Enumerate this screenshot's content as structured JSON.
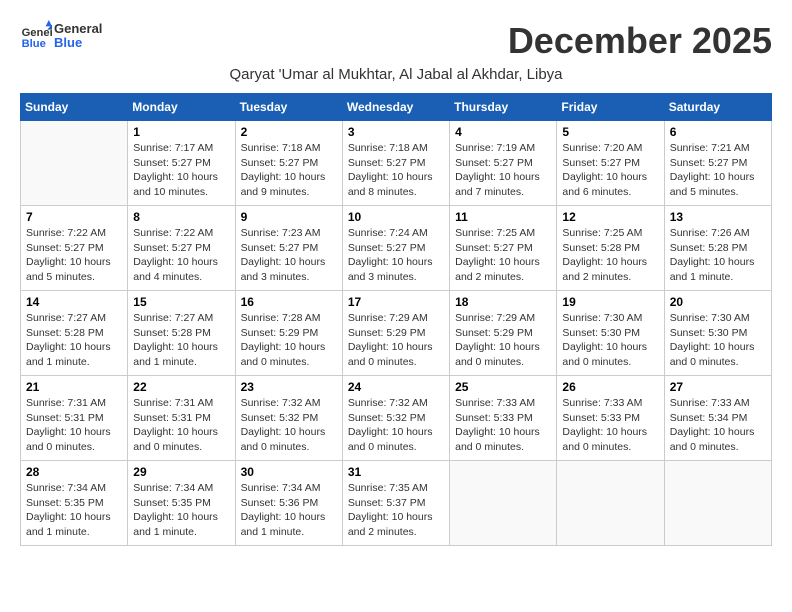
{
  "logo": {
    "general": "General",
    "blue": "Blue"
  },
  "title": "December 2025",
  "location": "Qaryat 'Umar al Mukhtar, Al Jabal al Akhdar, Libya",
  "weekdays": [
    "Sunday",
    "Monday",
    "Tuesday",
    "Wednesday",
    "Thursday",
    "Friday",
    "Saturday"
  ],
  "weeks": [
    [
      {
        "day": "",
        "info": ""
      },
      {
        "day": "1",
        "info": "Sunrise: 7:17 AM\nSunset: 5:27 PM\nDaylight: 10 hours\nand 10 minutes."
      },
      {
        "day": "2",
        "info": "Sunrise: 7:18 AM\nSunset: 5:27 PM\nDaylight: 10 hours\nand 9 minutes."
      },
      {
        "day": "3",
        "info": "Sunrise: 7:18 AM\nSunset: 5:27 PM\nDaylight: 10 hours\nand 8 minutes."
      },
      {
        "day": "4",
        "info": "Sunrise: 7:19 AM\nSunset: 5:27 PM\nDaylight: 10 hours\nand 7 minutes."
      },
      {
        "day": "5",
        "info": "Sunrise: 7:20 AM\nSunset: 5:27 PM\nDaylight: 10 hours\nand 6 minutes."
      },
      {
        "day": "6",
        "info": "Sunrise: 7:21 AM\nSunset: 5:27 PM\nDaylight: 10 hours\nand 5 minutes."
      }
    ],
    [
      {
        "day": "7",
        "info": "Sunrise: 7:22 AM\nSunset: 5:27 PM\nDaylight: 10 hours\nand 5 minutes."
      },
      {
        "day": "8",
        "info": "Sunrise: 7:22 AM\nSunset: 5:27 PM\nDaylight: 10 hours\nand 4 minutes."
      },
      {
        "day": "9",
        "info": "Sunrise: 7:23 AM\nSunset: 5:27 PM\nDaylight: 10 hours\nand 3 minutes."
      },
      {
        "day": "10",
        "info": "Sunrise: 7:24 AM\nSunset: 5:27 PM\nDaylight: 10 hours\nand 3 minutes."
      },
      {
        "day": "11",
        "info": "Sunrise: 7:25 AM\nSunset: 5:27 PM\nDaylight: 10 hours\nand 2 minutes."
      },
      {
        "day": "12",
        "info": "Sunrise: 7:25 AM\nSunset: 5:28 PM\nDaylight: 10 hours\nand 2 minutes."
      },
      {
        "day": "13",
        "info": "Sunrise: 7:26 AM\nSunset: 5:28 PM\nDaylight: 10 hours\nand 1 minute."
      }
    ],
    [
      {
        "day": "14",
        "info": "Sunrise: 7:27 AM\nSunset: 5:28 PM\nDaylight: 10 hours\nand 1 minute."
      },
      {
        "day": "15",
        "info": "Sunrise: 7:27 AM\nSunset: 5:28 PM\nDaylight: 10 hours\nand 1 minute."
      },
      {
        "day": "16",
        "info": "Sunrise: 7:28 AM\nSunset: 5:29 PM\nDaylight: 10 hours\nand 0 minutes."
      },
      {
        "day": "17",
        "info": "Sunrise: 7:29 AM\nSunset: 5:29 PM\nDaylight: 10 hours\nand 0 minutes."
      },
      {
        "day": "18",
        "info": "Sunrise: 7:29 AM\nSunset: 5:29 PM\nDaylight: 10 hours\nand 0 minutes."
      },
      {
        "day": "19",
        "info": "Sunrise: 7:30 AM\nSunset: 5:30 PM\nDaylight: 10 hours\nand 0 minutes."
      },
      {
        "day": "20",
        "info": "Sunrise: 7:30 AM\nSunset: 5:30 PM\nDaylight: 10 hours\nand 0 minutes."
      }
    ],
    [
      {
        "day": "21",
        "info": "Sunrise: 7:31 AM\nSunset: 5:31 PM\nDaylight: 10 hours\nand 0 minutes."
      },
      {
        "day": "22",
        "info": "Sunrise: 7:31 AM\nSunset: 5:31 PM\nDaylight: 10 hours\nand 0 minutes."
      },
      {
        "day": "23",
        "info": "Sunrise: 7:32 AM\nSunset: 5:32 PM\nDaylight: 10 hours\nand 0 minutes."
      },
      {
        "day": "24",
        "info": "Sunrise: 7:32 AM\nSunset: 5:32 PM\nDaylight: 10 hours\nand 0 minutes."
      },
      {
        "day": "25",
        "info": "Sunrise: 7:33 AM\nSunset: 5:33 PM\nDaylight: 10 hours\nand 0 minutes."
      },
      {
        "day": "26",
        "info": "Sunrise: 7:33 AM\nSunset: 5:33 PM\nDaylight: 10 hours\nand 0 minutes."
      },
      {
        "day": "27",
        "info": "Sunrise: 7:33 AM\nSunset: 5:34 PM\nDaylight: 10 hours\nand 0 minutes."
      }
    ],
    [
      {
        "day": "28",
        "info": "Sunrise: 7:34 AM\nSunset: 5:35 PM\nDaylight: 10 hours\nand 1 minute."
      },
      {
        "day": "29",
        "info": "Sunrise: 7:34 AM\nSunset: 5:35 PM\nDaylight: 10 hours\nand 1 minute."
      },
      {
        "day": "30",
        "info": "Sunrise: 7:34 AM\nSunset: 5:36 PM\nDaylight: 10 hours\nand 1 minute."
      },
      {
        "day": "31",
        "info": "Sunrise: 7:35 AM\nSunset: 5:37 PM\nDaylight: 10 hours\nand 2 minutes."
      },
      {
        "day": "",
        "info": ""
      },
      {
        "day": "",
        "info": ""
      },
      {
        "day": "",
        "info": ""
      }
    ]
  ]
}
